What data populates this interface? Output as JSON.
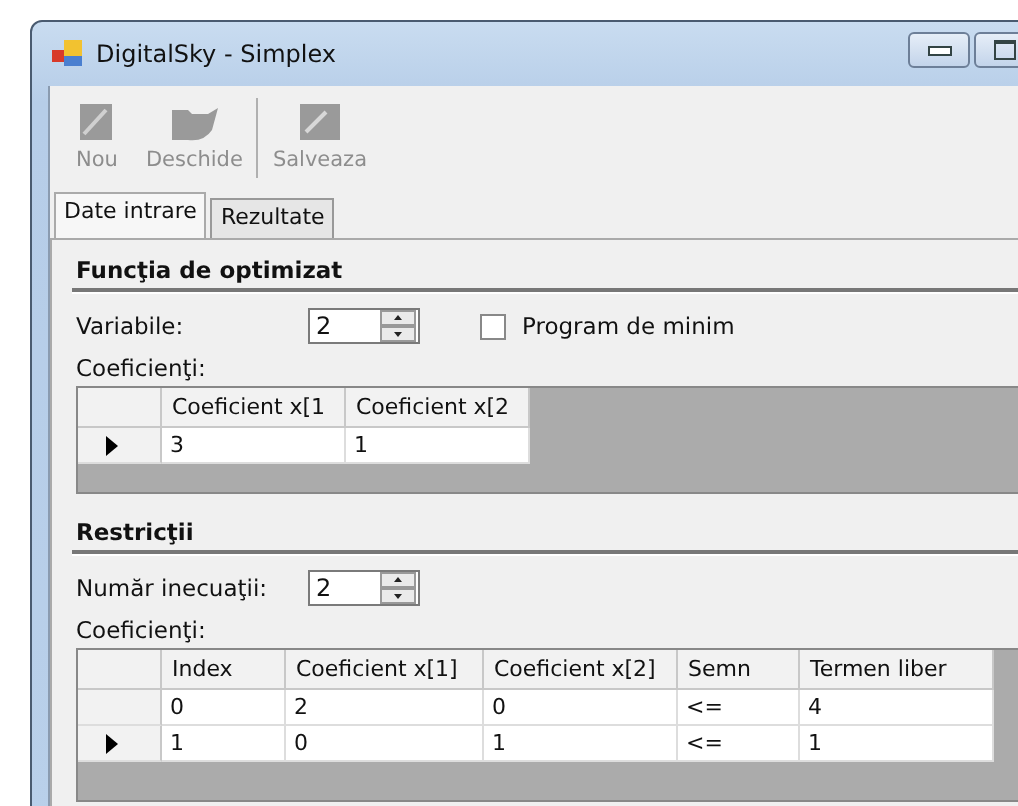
{
  "window": {
    "title": "DigitalSky - Simplex"
  },
  "toolbar": [
    {
      "kind": "new",
      "label": "Nou",
      "disabled": true
    },
    {
      "kind": "open",
      "label": "Deschide",
      "disabled": true
    },
    {
      "kind": "save",
      "label": "Salveaza",
      "disabled": true
    }
  ],
  "tabs": [
    {
      "label": "Date intrare",
      "selected": true
    },
    {
      "label": "Rezultate",
      "selected": false
    }
  ],
  "objective": {
    "title": "Funcţia de optimizat",
    "variables_label": "Variabile:",
    "variables_value": "2",
    "minimize": {
      "label": "Program de minim",
      "checked": false
    },
    "coefficients_label": "Coeficienţi:",
    "table": {
      "columns": [
        "Coeficient x[1",
        "Coeficient x[2"
      ],
      "rows": [
        {
          "selected": true,
          "cells": [
            "3",
            "1"
          ]
        }
      ]
    }
  },
  "constraints": {
    "title": "Restricţii",
    "count_label": "Număr inecuaţii:",
    "count_value": "2",
    "coefficients_label": "Coeficienţi:",
    "table": {
      "columns": [
        "Index",
        "Coeficient x[1]",
        "Coeficient x[2]",
        "Semn",
        "Termen liber"
      ],
      "rows": [
        {
          "selected": false,
          "cells": [
            "0",
            "2",
            "0",
            "<=",
            "4"
          ]
        },
        {
          "selected": true,
          "cells": [
            "1",
            "0",
            "1",
            "<=",
            "1"
          ]
        }
      ]
    }
  }
}
